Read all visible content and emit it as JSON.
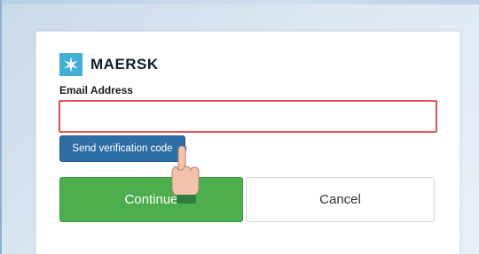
{
  "brand": {
    "name": "MAERSK",
    "logo_icon": "maersk-star-icon",
    "logo_color": "#42b0d5"
  },
  "form": {
    "email_label": "Email Address",
    "email_value": "",
    "email_placeholder": "",
    "send_code_label": "Send verification code",
    "continue_label": "Continue",
    "cancel_label": "Cancel"
  },
  "colors": {
    "continue_bg": "#4cae4c",
    "send_code_bg": "#2e6ea6",
    "input_highlight_border": "#e2515a"
  },
  "pointer": {
    "icon": "hand-pointer-icon"
  }
}
